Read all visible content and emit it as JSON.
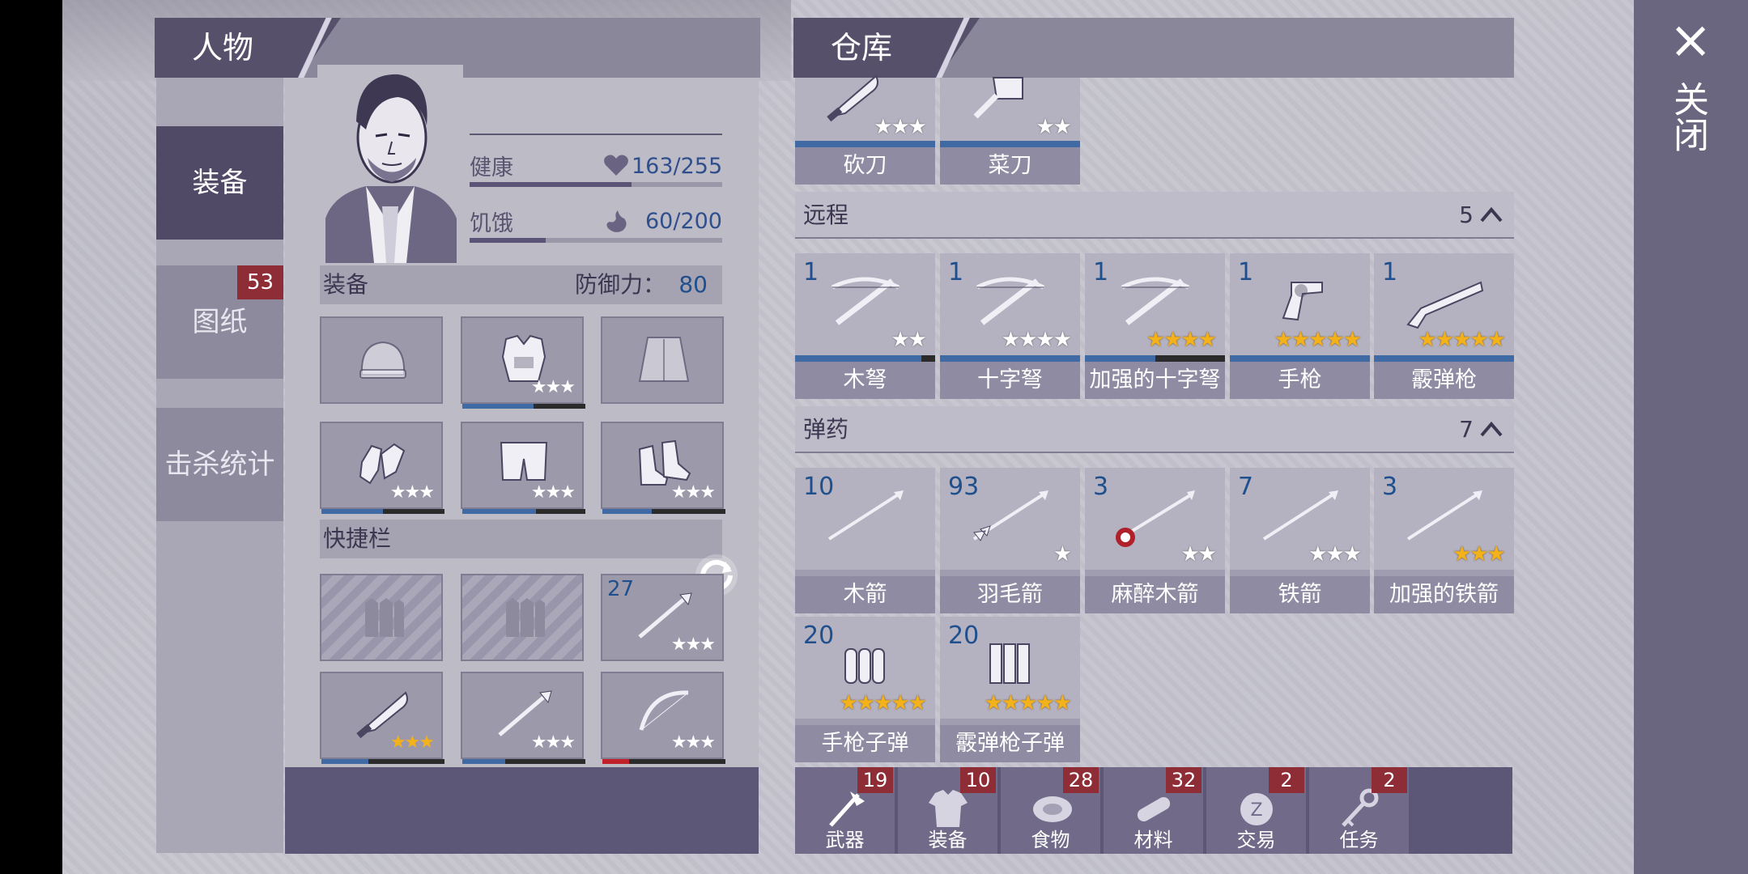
{
  "close": {
    "icon": "×",
    "label": "关闭"
  },
  "character_panel": {
    "title": "人物",
    "nav": [
      {
        "label": "装备"
      },
      {
        "label": "图纸",
        "badge": "53"
      },
      {
        "label": "击杀统计"
      }
    ],
    "stats": {
      "health_label": "健康",
      "health_value": "163/255",
      "health_fraction": 0.64,
      "hunger_label": "饥饿",
      "hunger_value": "60/200",
      "hunger_fraction": 0.3
    },
    "equipment_section": {
      "title": "装备",
      "defense_label": "防御力：",
      "defense_value": "80"
    },
    "equipment": [
      {
        "icon": "beanie-icon",
        "stars": ""
      },
      {
        "icon": "vest-icon",
        "stars": "★★★",
        "durability": 0.58
      },
      {
        "icon": "jacket-icon",
        "stars": ""
      },
      {
        "icon": "gloves-icon",
        "stars": "★★★",
        "durability": 0.5
      },
      {
        "icon": "shorts-icon",
        "stars": "★★★",
        "durability": 0.6
      },
      {
        "icon": "boots-icon",
        "stars": "★★★",
        "durability": 0.4
      }
    ],
    "quickbar_title": "快捷栏",
    "quickbar": [
      {
        "icon": "empty-slot-icon",
        "stars": ""
      },
      {
        "icon": "empty-slot-icon",
        "stars": ""
      },
      {
        "icon": "spear-icon",
        "stars": "★★★",
        "count": "27"
      },
      {
        "icon": "machete-icon",
        "stars": "★★★",
        "gold": true,
        "durability": 0.38
      },
      {
        "icon": "spear-icon",
        "stars": "★★★",
        "durability": 0.35
      },
      {
        "icon": "bow-icon",
        "stars": "★★★",
        "durability": 0.22,
        "durability_color": "#c0202a"
      }
    ]
  },
  "warehouse": {
    "title": "仓库",
    "top_items": [
      {
        "label": "砍刀",
        "stars": "★★★",
        "icon": "machete-icon"
      },
      {
        "label": "菜刀",
        "stars": "★★",
        "icon": "cleaver-icon"
      }
    ],
    "ranged": {
      "title": "远程",
      "count": "5",
      "items": [
        {
          "label": "木弩",
          "count": "1",
          "stars": "★★",
          "gold": false,
          "icon": "crossbow-icon",
          "durability": 0.9
        },
        {
          "label": "十字弩",
          "count": "1",
          "stars": "★★★★",
          "gold": false,
          "icon": "crossbow-icon",
          "durability": 1.0
        },
        {
          "label": "加强的十字弩",
          "count": "1",
          "stars": "★★★★",
          "gold": true,
          "icon": "crossbow-icon",
          "durability": 0.5
        },
        {
          "label": "手枪",
          "count": "1",
          "stars": "★★★★★",
          "gold": true,
          "icon": "revolver-icon",
          "durability": 1.0
        },
        {
          "label": "霰弹枪",
          "count": "1",
          "stars": "★★★★★",
          "gold": true,
          "icon": "shotgun-icon",
          "durability": 1.0
        }
      ]
    },
    "ammo": {
      "title": "弹药",
      "count": "7",
      "items": [
        {
          "label": "木箭",
          "count": "10",
          "stars": "",
          "gold": false,
          "icon": "arrow-icon"
        },
        {
          "label": "羽毛箭",
          "count": "93",
          "stars": "★",
          "gold": false,
          "icon": "feather-arrow-icon"
        },
        {
          "label": "麻醉木箭",
          "count": "3",
          "stars": "★★",
          "gold": false,
          "icon": "tranquilizer-arrow-icon"
        },
        {
          "label": "铁箭",
          "count": "7",
          "stars": "★★★",
          "gold": false,
          "icon": "arrow-icon"
        },
        {
          "label": "加强的铁箭",
          "count": "3",
          "stars": "★★★",
          "gold": true,
          "icon": "arrow-icon"
        },
        {
          "label": "手枪子弹",
          "count": "20",
          "stars": "★★★★★",
          "gold": true,
          "icon": "bullets-icon"
        },
        {
          "label": "霰弹枪子弹",
          "count": "20",
          "stars": "★★★★★",
          "gold": true,
          "icon": "shells-icon"
        }
      ]
    },
    "tabs": [
      {
        "label": "武器",
        "badge": "19",
        "icon": "axe-icon"
      },
      {
        "label": "装备",
        "badge": "10",
        "icon": "shirt-icon"
      },
      {
        "label": "食物",
        "badge": "28",
        "icon": "meat-icon"
      },
      {
        "label": "材料",
        "badge": "32",
        "icon": "log-icon"
      },
      {
        "label": "交易",
        "badge": "2",
        "icon": "coin-icon"
      },
      {
        "label": "任务",
        "badge": "2",
        "icon": "key-icon"
      }
    ]
  }
}
